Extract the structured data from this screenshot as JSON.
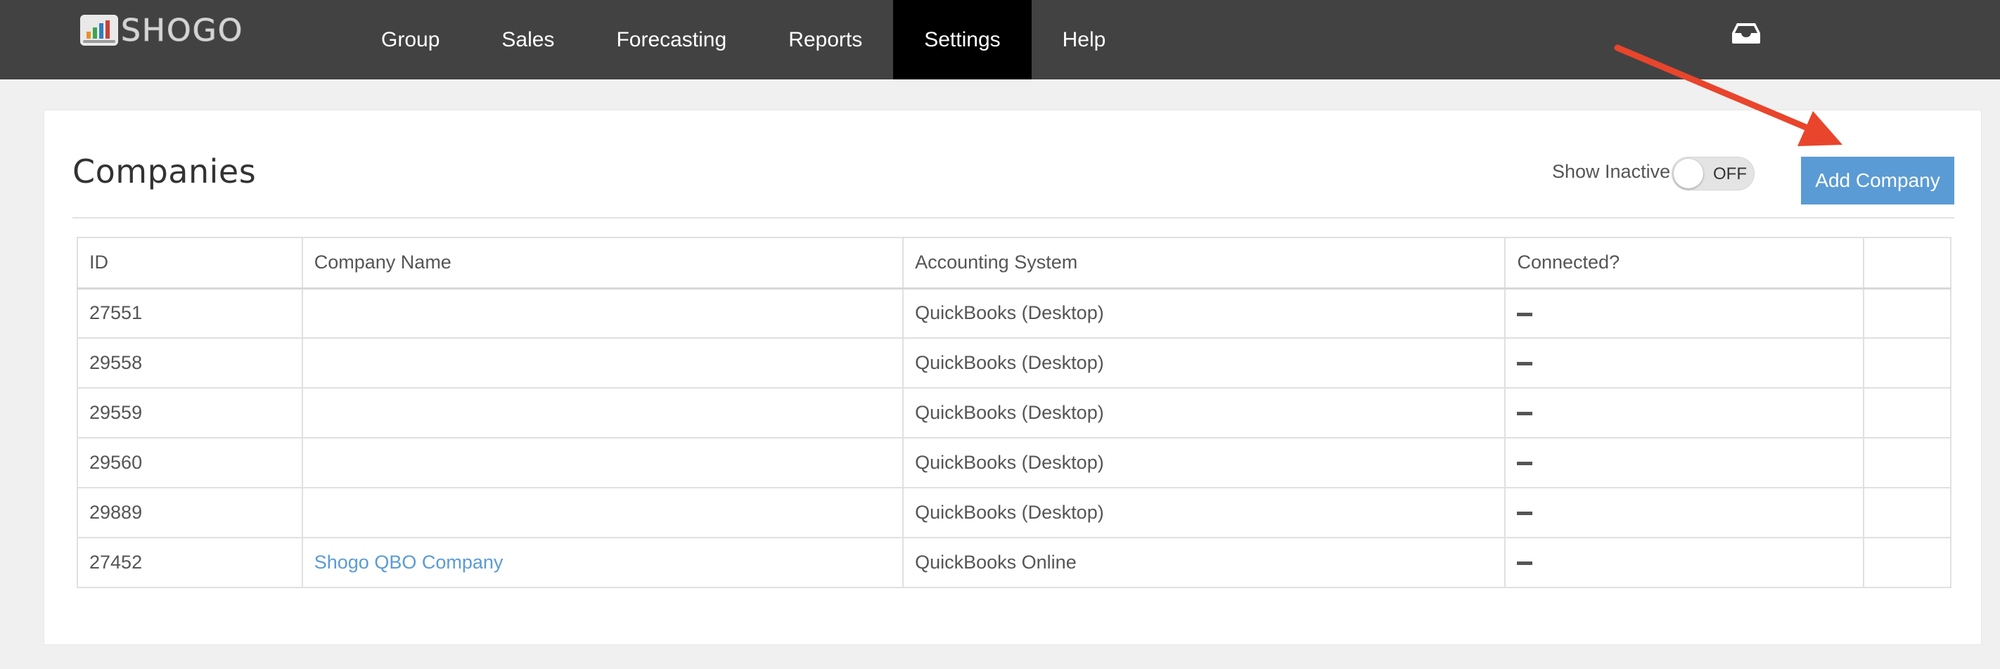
{
  "brand": {
    "name": "SHOGO"
  },
  "nav": {
    "items": [
      {
        "label": "Group"
      },
      {
        "label": "Sales"
      },
      {
        "label": "Forecasting"
      },
      {
        "label": "Reports"
      },
      {
        "label": "Settings",
        "active": true
      },
      {
        "label": "Help"
      }
    ]
  },
  "header": {
    "inbox_icon": "inbox-icon"
  },
  "page": {
    "title": "Companies",
    "show_inactive_label": "Show Inactive",
    "toggle_state": "OFF",
    "add_button_label": "Add Company"
  },
  "table": {
    "columns": [
      "ID",
      "Company Name",
      "Accounting System",
      "Connected?",
      ""
    ],
    "rows": [
      {
        "id": "27551",
        "company_name": "",
        "accounting_system": "QuickBooks (Desktop)",
        "connected": "dash"
      },
      {
        "id": "29558",
        "company_name": "",
        "accounting_system": "QuickBooks (Desktop)",
        "connected": "dash"
      },
      {
        "id": "29559",
        "company_name": "",
        "accounting_system": "QuickBooks (Desktop)",
        "connected": "dash"
      },
      {
        "id": "29560",
        "company_name": "",
        "accounting_system": "QuickBooks (Desktop)",
        "connected": "dash"
      },
      {
        "id": "29889",
        "company_name": "",
        "accounting_system": "QuickBooks (Desktop)",
        "connected": "dash"
      },
      {
        "id": "27452",
        "company_name": "Shogo QBO Company",
        "accounting_system": "QuickBooks Online",
        "connected": "dash"
      }
    ]
  },
  "colors": {
    "topbar": "#424242",
    "nav_active": "#000000",
    "accent": "#5b9bd5",
    "annotation_arrow": "#e8452c"
  }
}
